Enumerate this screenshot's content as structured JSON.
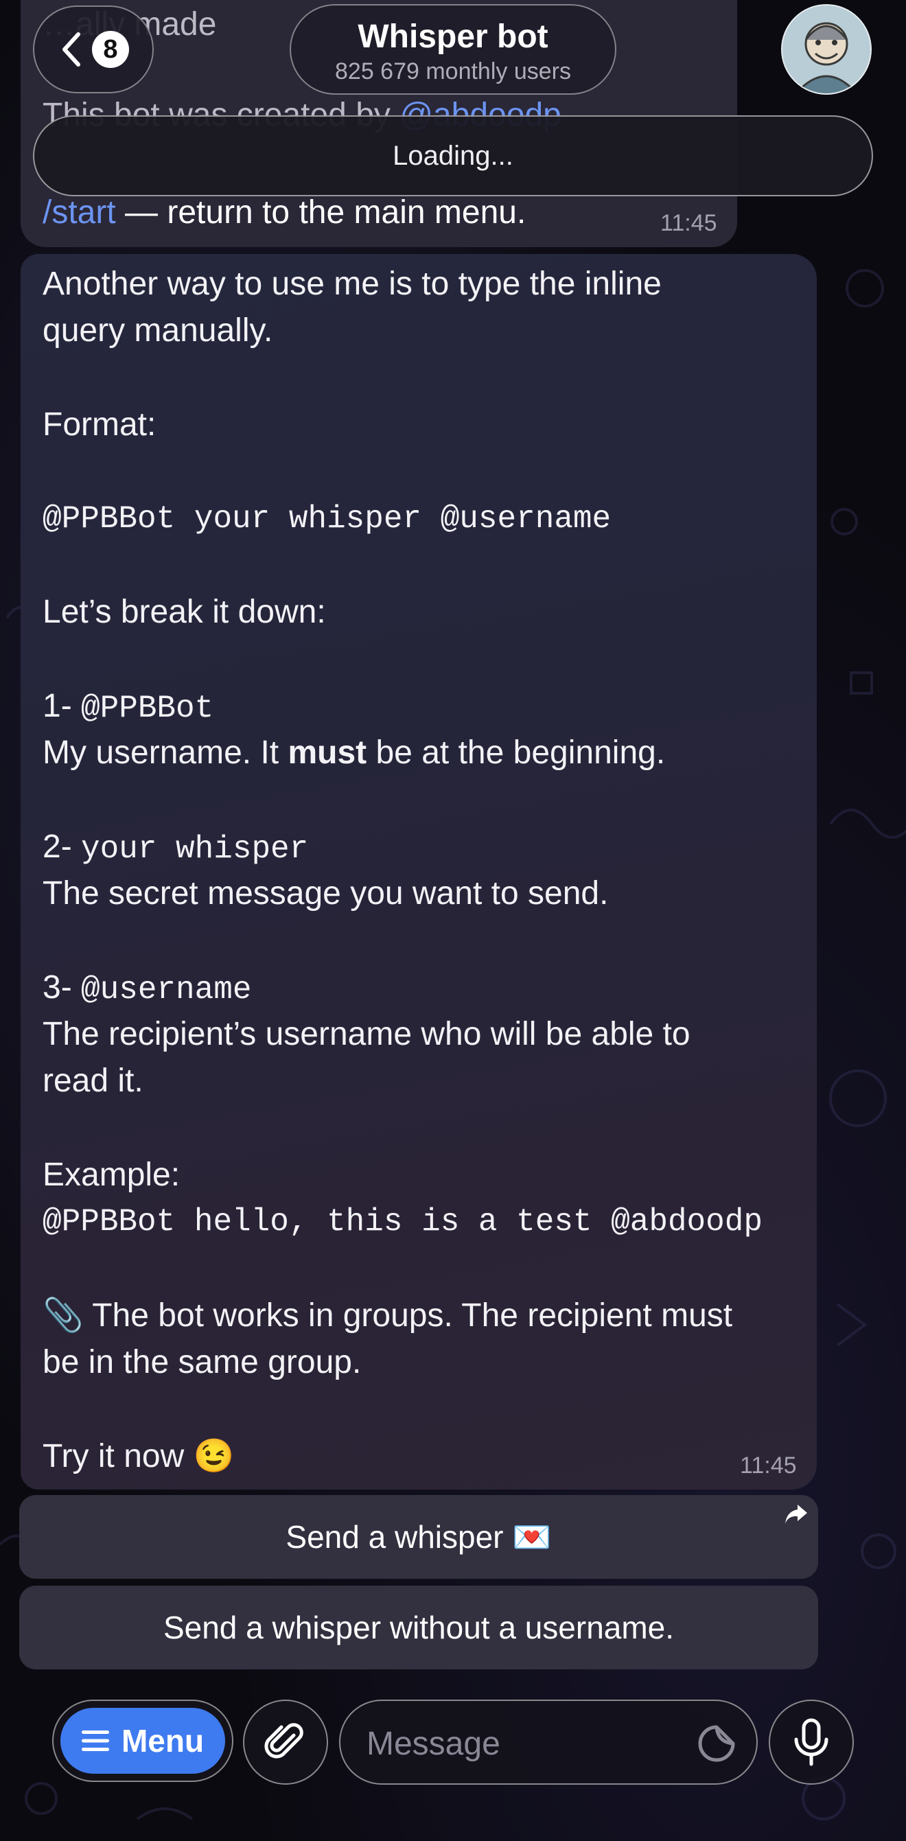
{
  "header": {
    "back_count": "8",
    "title": "Whisper bot",
    "subtitle": "825 679 monthly users",
    "loading": "Loading...",
    "avatar": "bot-avatar"
  },
  "previous_message": {
    "line1": "…ally made",
    "line2_text": "This bot was created by ",
    "line2_link": "@abdoodp",
    "line3_cmd": "/start",
    "line3_text": " — return to the main menu.",
    "time": "11:45"
  },
  "message": {
    "intro1": "Another way to use me is to type the inline",
    "intro2": "query manually.",
    "format_label": "Format:",
    "format_code": "@PPBBot your whisper @username",
    "breakdown": "Let’s break it down:",
    "item1_num": "1- ",
    "item1_code": "@PPBBot",
    "item1_desc_a": "My username. It ",
    "item1_desc_bold": "must",
    "item1_desc_b": " be at the beginning.",
    "item2_num": "2- ",
    "item2_code": "your whisper",
    "item2_desc": "The secret message you want to send.",
    "item3_num": "3- ",
    "item3_code": "@username",
    "item3_desc1": "The recipient’s username who will be able to",
    "item3_desc2": "read it.",
    "example_label": "Example:",
    "example_code": "@PPBBot hello, this is a test @abdoodp",
    "note1": "📎 The bot works in groups. The recipient must",
    "note2": "be in the same group.",
    "try_now": "Try it now 😉",
    "time": "11:45"
  },
  "inline_buttons": [
    {
      "label": "Send a whisper 💌"
    },
    {
      "label": "Send a whisper without a username."
    }
  ],
  "composer": {
    "menu_label": "Menu",
    "placeholder": "Message"
  },
  "colors": {
    "accent": "#3f7bf0",
    "link": "#6c94f2",
    "bubble": "#25273d",
    "button": "#33303f"
  }
}
